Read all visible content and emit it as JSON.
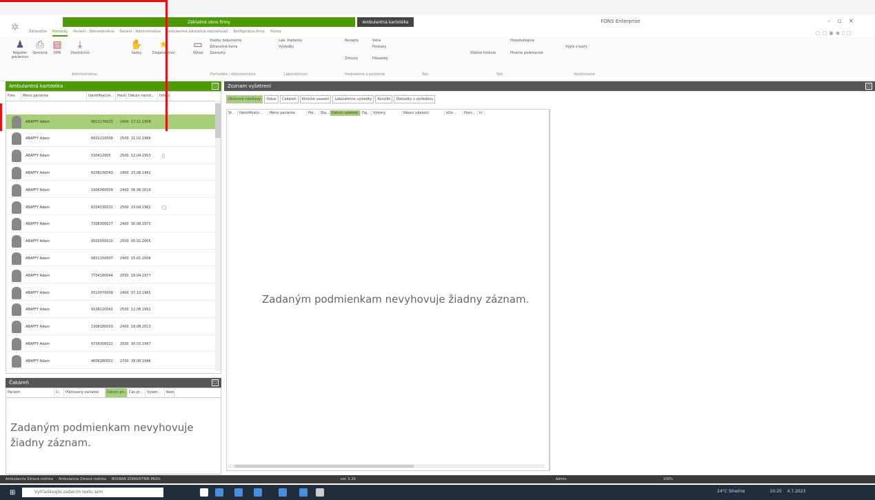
{
  "window": {
    "app_title": "FONS Enterprise",
    "context_tab_1": "Základné okno firmy",
    "context_tab_2": "Ambulantná kartotéka"
  },
  "ribbon_tabs": [
    "Zdravotné",
    "Pomôcky",
    "Pacient - Dokumentácia",
    "Pacient - Administratíva",
    "Ambulantná zdravotná starostlivosť",
    "Konfigurácia firmy",
    "Pomoc"
  ],
  "ribbon": {
    "buttons": [
      "Register pacientov",
      "Servisná",
      "DPN",
      "Vlastníctvo",
      "Vazby",
      "Dispečerstvo",
      "Výkaz"
    ],
    "small": [
      "Všetky dokumenty",
      "Zdravotná karta",
      "Záznamy",
      "Lab. žiadanky",
      "Výsledky",
      "Recepty",
      "Vaňa",
      "Poukazy",
      "Zmluvy",
      "Hlásenky",
      "Vitálne funkcie",
      "Hospitalizácia",
      "Plnenie podmienok",
      "Výpis z karty"
    ],
    "groups": [
      "Administratíva",
      "Formuláre / dokumentácia",
      "Laboratórium",
      "Hodnotenie a poistenie",
      "Šek",
      "Šek",
      "Vyúčtovanie"
    ]
  },
  "left_panel": {
    "title": "Ambulantná kartotéka",
    "columns": [
      "Foto",
      "Meno pacienta",
      "Identifikačné...",
      "Poisťa",
      "Dátum narod...",
      "Info pa"
    ],
    "rows": [
      {
        "name": "ABAFFY Adam",
        "id": "5811176015",
        "poist": "2400",
        "date": "17.11.1958",
        "info": "",
        "selected": true
      },
      {
        "name": "ABAFFY Adam",
        "id": "6602210008",
        "poist": "2500",
        "date": "21.02.1966",
        "info": ""
      },
      {
        "name": "ABAFFY Adam",
        "id": "530412005",
        "poist": "2500",
        "date": "12.04.1953",
        "info": "▯"
      },
      {
        "name": "ABAFFY Adam",
        "id": "6208230043",
        "poist": "2400",
        "date": "23.08.1962",
        "info": ""
      },
      {
        "name": "ABAFFY Adam",
        "id": "1906060009",
        "poist": "2400",
        "date": "06.06.2019",
        "info": ""
      },
      {
        "name": "ABAFFY Adam",
        "id": "6204230032",
        "poist": "2500",
        "date": "23.04.1962",
        "info": "▢"
      },
      {
        "name": "ABAFFY Adam",
        "id": "7308300027",
        "poist": "2400",
        "date": "30.08.1973",
        "info": ""
      },
      {
        "name": "ABAFFY Adam",
        "id": "0502050010",
        "poist": "2500",
        "date": "05.02.2005",
        "info": ""
      },
      {
        "name": "ABAFFY Adam",
        "id": "0601150007",
        "poist": "2400",
        "date": "15.01.2006",
        "info": ""
      },
      {
        "name": "ABAFFY Adam",
        "id": "7704180044",
        "poist": "2500",
        "date": "18.04.1977",
        "info": ""
      },
      {
        "name": "ABAFFY Adam",
        "id": "0510070009",
        "poist": "2400",
        "date": "07.10.1965",
        "info": ""
      },
      {
        "name": "ABAFFY Adam",
        "id": "9108120042",
        "poist": "2500",
        "date": "12.08.1991",
        "info": ""
      },
      {
        "name": "ABAFFY Adam",
        "id": "1308180003",
        "poist": "2400",
        "date": "18.08.2013",
        "info": ""
      },
      {
        "name": "ABAFFY Adam",
        "id": "9709300022",
        "poist": "2500",
        "date": "30.03.1997",
        "info": ""
      },
      {
        "name": "ABAFFY Adam",
        "id": "4608280001",
        "poist": "2700",
        "date": "28.08.1946",
        "info": ""
      }
    ]
  },
  "bottom_left_panel": {
    "title": "Čakáreň",
    "columns": [
      "Pacient",
      "U..",
      "Plánovaný začiatok",
      "Dátum pri...",
      "Čas pr...",
      "Vyšetr...",
      "Nezo"
    ],
    "empty_text": "Zadaným podmienkam nevyhovuje žiadny záznam."
  },
  "right_panel": {
    "title": "Zoznam vyšetrení",
    "tabs": [
      "Ošetrené návštevy",
      "Dokar",
      "Čakáreň",
      "Klinické usasení",
      "Laboratórne výsledky",
      "Konzílik",
      "Dokladky s výsledkou"
    ],
    "columns": [
      "St..",
      "Identifikačn...",
      "Meno pacienta",
      "Poi...",
      "Sta...",
      "Dátum udalosti",
      "Dg.",
      "Výkony",
      "Názov udalosti",
      "eDo...",
      "Pozn...",
      "In"
    ],
    "empty_text": "Zadaným podmienkam nevyhovuje žiadny záznam."
  },
  "status_bar": [
    "Ambulancia Zdravá rodinka",
    "Ambulancia Zdravá rodinka",
    "BOSNAR ZDRAVOTNÍK MUDr.",
    "ver. 5.20",
    "Admin",
    "100%"
  ],
  "taskbar": {
    "search_placeholder": "Vyhľadávajte zadaním textu sem",
    "weather": "24°C Slnečno",
    "time": "10:25",
    "date": "4.7.2023"
  },
  "colors": {
    "accent": "#4e9a06",
    "selected_row": "#a6cf78",
    "dark_header": "#555555",
    "highlight_box": "#e81010"
  }
}
